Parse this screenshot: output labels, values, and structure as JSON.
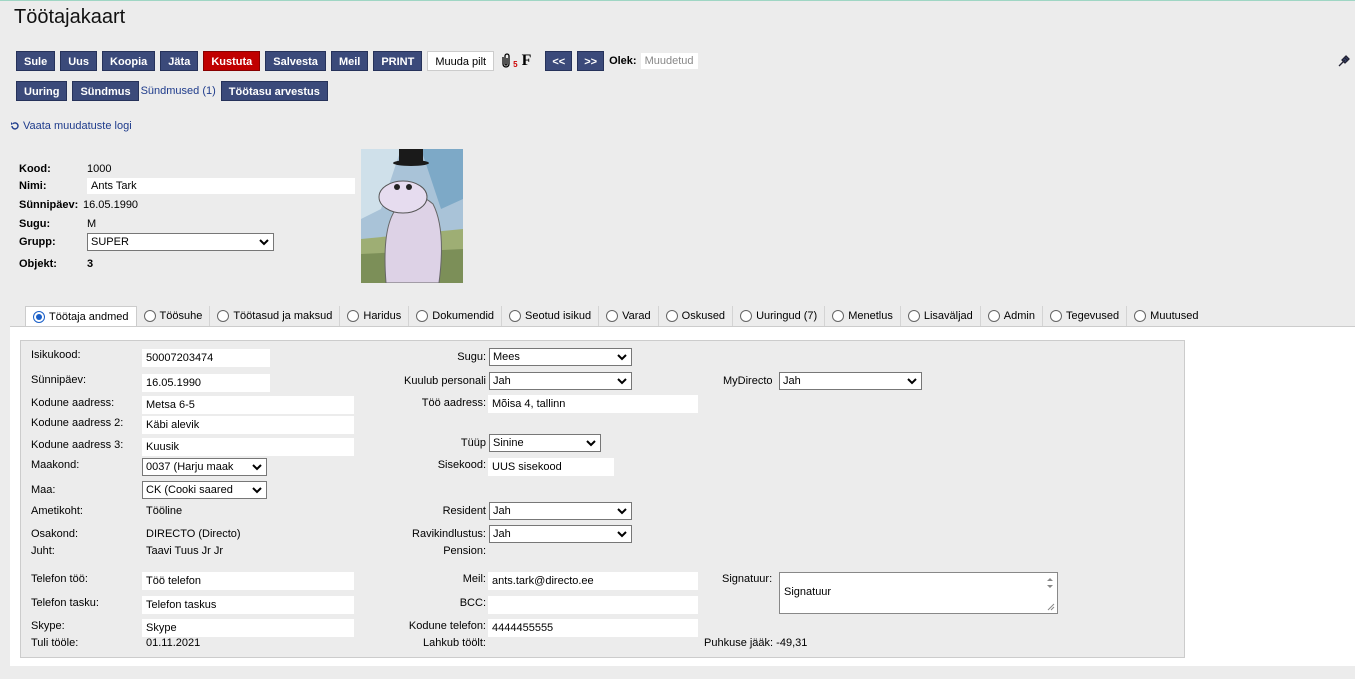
{
  "page": {
    "title": "Töötajakaart"
  },
  "toolbar": {
    "buttons": [
      "Sule",
      "Uus",
      "Koopia",
      "Jäta",
      "Kustuta",
      "Salvesta",
      "Meil",
      "PRINT"
    ],
    "change_picture": "Muuda pilt",
    "attach_count": "5",
    "f_label": "F",
    "prev": "<<",
    "next": ">>",
    "status_label": "Olek:",
    "status_value": "Muudetud"
  },
  "toolbar2": {
    "uuring": "Uuring",
    "sundmus": "Sündmus",
    "sundmused": "Sündmused (1)",
    "tootasu": "Töötasu arvestus"
  },
  "log_link": "Vaata muudatuste logi",
  "header": {
    "kood_label": "Kood:",
    "kood": "1000",
    "nimi_label": "Nimi:",
    "nimi": "Ants Tark",
    "synd_label": "Sünnipäev:",
    "synd": "16.05.1990",
    "sugu_label": "Sugu:",
    "sugu": "M",
    "grupp_label": "Grupp:",
    "grupp": "SUPER",
    "objekt_label": "Objekt:",
    "objekt": "3"
  },
  "tabs": [
    "Töötaja andmed",
    "Töösuhe",
    "Töötasud ja maksud",
    "Haridus",
    "Dokumendid",
    "Seotud isikud",
    "Varad",
    "Oskused",
    "Uuringud (7)",
    "Menetlus",
    "Lisaväljad",
    "Admin",
    "Tegevused",
    "Muutused"
  ],
  "form": {
    "isikukood_label": "Isikukood:",
    "isikukood": "50007203474",
    "synnipaev_label": "Sünnipäev:",
    "synnipaev": "16.05.1990",
    "aadress_label": "Kodune aadress:",
    "aadress": "Metsa 6-5",
    "aadress2_label": "Kodune aadress 2:",
    "aadress2": "Käbi alevik",
    "aadress3_label": "Kodune aadress 3:",
    "aadress3": "Kuusik",
    "maakond_label": "Maakond:",
    "maakond": "0037 (Harju maak",
    "maa_label": "Maa:",
    "maa": "CK (Cooki saared",
    "ametikoht_label": "Ametikoht:",
    "ametikoht": "Tööline",
    "osakond_label": "Osakond:",
    "osakond": "DIRECTO (Directo)",
    "juht_label": "Juht:",
    "juht": "Taavi Tuus Jr Jr",
    "telefon_too_label": "Telefon töö:",
    "telefon_too": "Töö telefon",
    "telefon_tasku_label": "Telefon tasku:",
    "telefon_tasku": "Telefon taskus",
    "skype_label": "Skype:",
    "skype": "Skype",
    "tuli_label": "Tuli tööle:",
    "tuli": "01.11.2021",
    "sugu_label": "Sugu:",
    "sugu": "Mees",
    "personal_label": "Kuulub personali",
    "personal": "Jah",
    "too_aadress_label": "Töö aadress:",
    "too_aadress": "Mõisa 4, tallinn",
    "tuup_label": "Tüüp",
    "tuup": "Sinine",
    "sisekood_label": "Sisekood:",
    "sisekood": "UUS sisekood",
    "resident_label": "Resident",
    "resident": "Jah",
    "ravi_label": "Ravikindlustus:",
    "ravi": "Jah",
    "pension_label": "Pension:",
    "meil_label": "Meil:",
    "meil": "ants.tark@directo.ee",
    "bcc_label": "BCC:",
    "kodune_tel_label": "Kodune telefon:",
    "kodune_tel": "4444455555",
    "lahkub_label": "Lahkub töölt:",
    "mydirecto_label": "MyDirecto",
    "mydirecto": "Jah",
    "signatuur_label": "Signatuur:",
    "signatuur": "Signatuur",
    "puhkus_label": "Puhkuse jääk:",
    "puhkus": "-49,31"
  }
}
